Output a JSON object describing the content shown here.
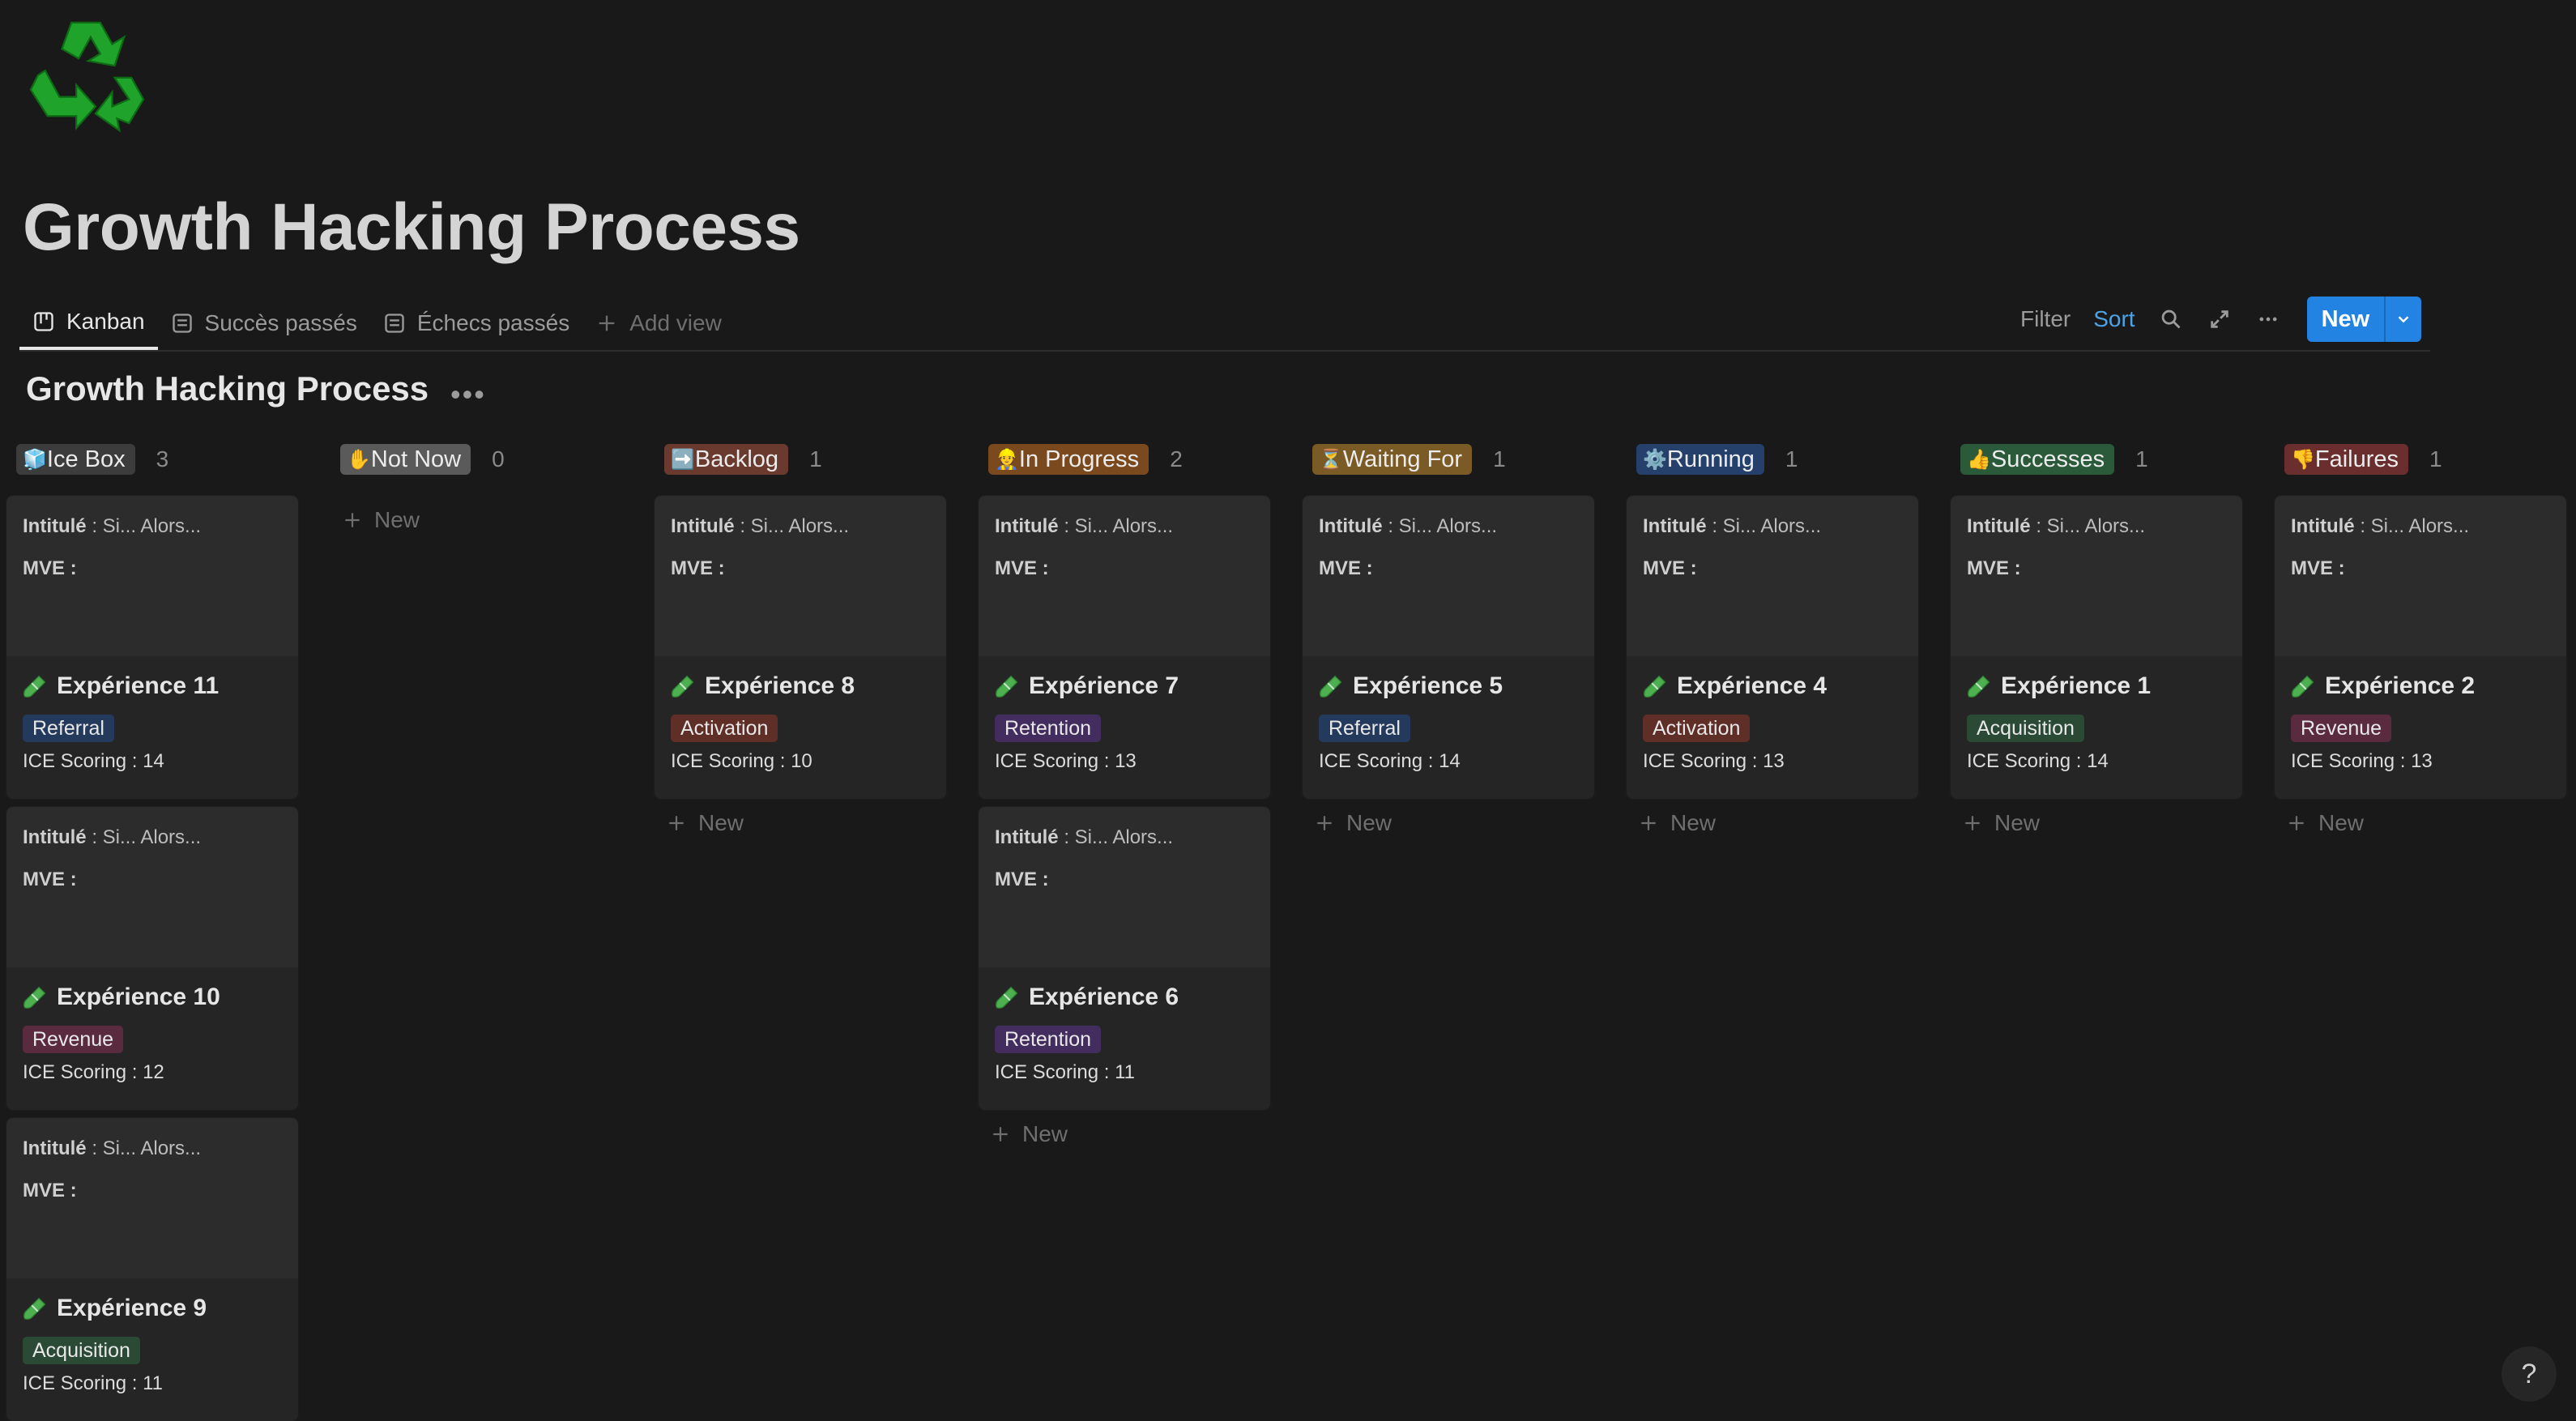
{
  "page": {
    "icon": "recycle-icon",
    "title": "Growth Hacking Process"
  },
  "views": [
    {
      "label": "Kanban",
      "icon": "board-icon",
      "active": true
    },
    {
      "label": "Succès passés",
      "icon": "list-icon",
      "active": false
    },
    {
      "label": "Échecs passés",
      "icon": "list-icon",
      "active": false
    },
    {
      "label": "Add view",
      "icon": "plus-icon",
      "active": false
    }
  ],
  "toolbar": {
    "filter": "Filter",
    "sort": "Sort",
    "new": "New"
  },
  "board": {
    "title": "Growth Hacking Process",
    "new_label": "New",
    "cover": {
      "intitule_label": "Intitulé",
      "intitule_value": ": Si... Alors...",
      "mve_label": "MVE :"
    },
    "score_label": "ICE Scoring : ",
    "columns": [
      {
        "emoji": "🧊",
        "name": "Ice Box",
        "count": "3",
        "pill_color": "#3c3c3c",
        "cards": [
          {
            "title": "Expérience 11",
            "tag": "Referral",
            "tag_color": "#243a5c",
            "score": "14"
          },
          {
            "title": "Expérience 10",
            "tag": "Revenue",
            "tag_color": "#5a2a3e",
            "score": "12"
          },
          {
            "title": "Expérience 9",
            "tag": "Acquisition",
            "tag_color": "#2a4a35",
            "score": "11"
          }
        ]
      },
      {
        "emoji": "✋",
        "name": "Not Now",
        "count": "0",
        "pill_color": "#5a5a5a",
        "cards": []
      },
      {
        "emoji": "➡️",
        "name": "Backlog",
        "count": "1",
        "pill_color": "#6b3a2e",
        "cards": [
          {
            "title": "Expérience 8",
            "tag": "Activation",
            "tag_color": "#5e2e27",
            "score": "10"
          }
        ]
      },
      {
        "emoji": "👷",
        "name": "In Progress",
        "count": "2",
        "pill_color": "#7a4a1e",
        "cards": [
          {
            "title": "Expérience 7",
            "tag": "Retention",
            "tag_color": "#432c5e",
            "score": "13"
          },
          {
            "title": "Expérience 6",
            "tag": "Retention",
            "tag_color": "#432c5e",
            "score": "11"
          }
        ]
      },
      {
        "emoji": "⏳",
        "name": "Waiting For",
        "count": "1",
        "pill_color": "#7a5a25",
        "cards": [
          {
            "title": "Expérience 5",
            "tag": "Referral",
            "tag_color": "#243a5c",
            "score": "14"
          }
        ]
      },
      {
        "emoji": "⚙️",
        "name": "Running",
        "count": "1",
        "pill_color": "#25406a",
        "cards": [
          {
            "title": "Expérience 4",
            "tag": "Activation",
            "tag_color": "#5e2e27",
            "score": "13"
          }
        ]
      },
      {
        "emoji": "👍",
        "name": "Successes",
        "count": "1",
        "pill_color": "#2a5a3a",
        "cards": [
          {
            "title": "Expérience 1",
            "tag": "Acquisition",
            "tag_color": "#2a4a35",
            "score": "14"
          }
        ]
      },
      {
        "emoji": "👎",
        "name": "Failures",
        "count": "1",
        "pill_color": "#6a2e2e",
        "cards": [
          {
            "title": "Expérience 2",
            "tag": "Revenue",
            "tag_color": "#5a2a3e",
            "score": "13"
          }
        ]
      }
    ]
  },
  "help": "?"
}
